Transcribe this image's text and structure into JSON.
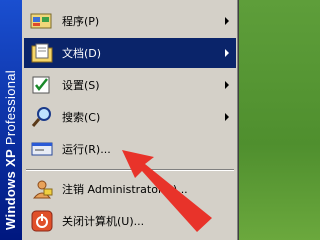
{
  "sidebar": {
    "brand_bold": "Windows XP",
    "brand_light": " Professional"
  },
  "menu": {
    "items": [
      {
        "label": "程序(P)",
        "icon": "programs-icon",
        "has_submenu": true
      },
      {
        "label": "文档(D)",
        "icon": "documents-icon",
        "has_submenu": true
      },
      {
        "label": "设置(S)",
        "icon": "settings-icon",
        "has_submenu": true
      },
      {
        "label": "搜索(C)",
        "icon": "search-icon",
        "has_submenu": true
      },
      {
        "label": "运行(R)...",
        "icon": "run-icon",
        "has_submenu": false
      },
      {
        "label": "注销 Administrator(L)...",
        "icon": "logoff-icon",
        "has_submenu": false
      },
      {
        "label": "关闭计算机(U)...",
        "icon": "shutdown-icon",
        "has_submenu": false
      }
    ],
    "highlighted_item": "文档(D)"
  },
  "annotation": {
    "type": "arrow",
    "color": "#e8332a",
    "points_to": "运行(R)..."
  }
}
